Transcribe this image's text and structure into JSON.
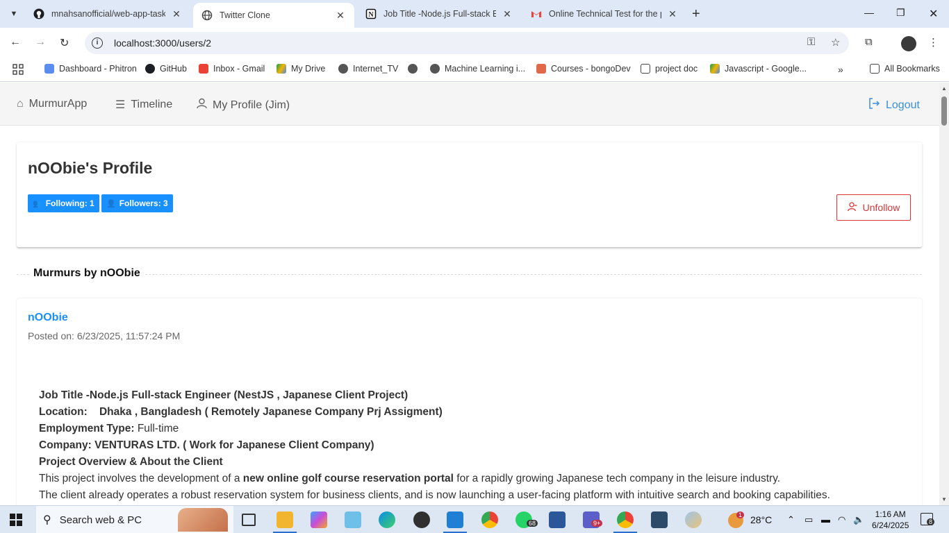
{
  "browser": {
    "tabs": [
      {
        "title": "mnahsanofficial/web-app-task",
        "icon": "github-icon",
        "active": false
      },
      {
        "title": "Twitter Clone",
        "icon": "globe-icon",
        "active": true
      },
      {
        "title": "Job Title -Node.js Full-stack Eng",
        "icon": "notion-icon",
        "active": false
      },
      {
        "title": "Online Technical Test for the po",
        "icon": "gmail-icon",
        "active": false
      }
    ],
    "url": "localhost:3000/users/2",
    "bookmarks": [
      "Dashboard - Phitron",
      "GitHub",
      "Inbox - Gmail",
      "My Drive",
      "Internet_TV",
      "",
      "Machine Learning i...",
      "Courses - bongoDev",
      "project doc",
      "Javascript - Google..."
    ],
    "all_bookmarks": "All Bookmarks"
  },
  "nav": {
    "brand": "MurmurApp",
    "timeline": "Timeline",
    "profile": "My Profile (Jim)",
    "logout": "Logout"
  },
  "profile": {
    "title": "nOObie's Profile",
    "following": "Following: 1",
    "followers": "Followers: 3",
    "unfollow": "Unfollow"
  },
  "section": {
    "title": "Murmurs by nOObie"
  },
  "post": {
    "author": "nOObie",
    "posted": "Posted on: 6/23/2025, 11:57:24 PM",
    "line1": "Job Title -Node.js Full-stack Engineer (NestJS , Japanese Client Project)",
    "line2_label": "Location:",
    "line2_value": "Dhaka , Bangladesh ( Remotely Japanese Company Prj Assigment)",
    "line3_label": "Employment Type:",
    "line3_value": " Full-time",
    "line4": "Company: VENTURAS LTD. ( Work for Japanese Client Company)",
    "line5": "Project Overview & About the Client",
    "line6_pre": "This project involves the development of a ",
    "line6_bold": "new online golf course reservation portal",
    "line6_post": " for a rapidly growing Japanese tech company in the leisure industry.",
    "line7": "The client already operates a robust reservation system for business clients, and is now launching a user-facing platform with intuitive search and booking capabilities."
  },
  "taskbar": {
    "search": "Search web & PC",
    "weather": "28°C",
    "time": "1:16 AM",
    "date": "6/24/2025",
    "whatsapp_badge": "68",
    "teams_badge": "9+",
    "weather_badge": "1",
    "notif_badge": "8"
  },
  "colors": {
    "accent": "#1890ff",
    "danger": "#d93636",
    "link": "#3a8fd8"
  }
}
